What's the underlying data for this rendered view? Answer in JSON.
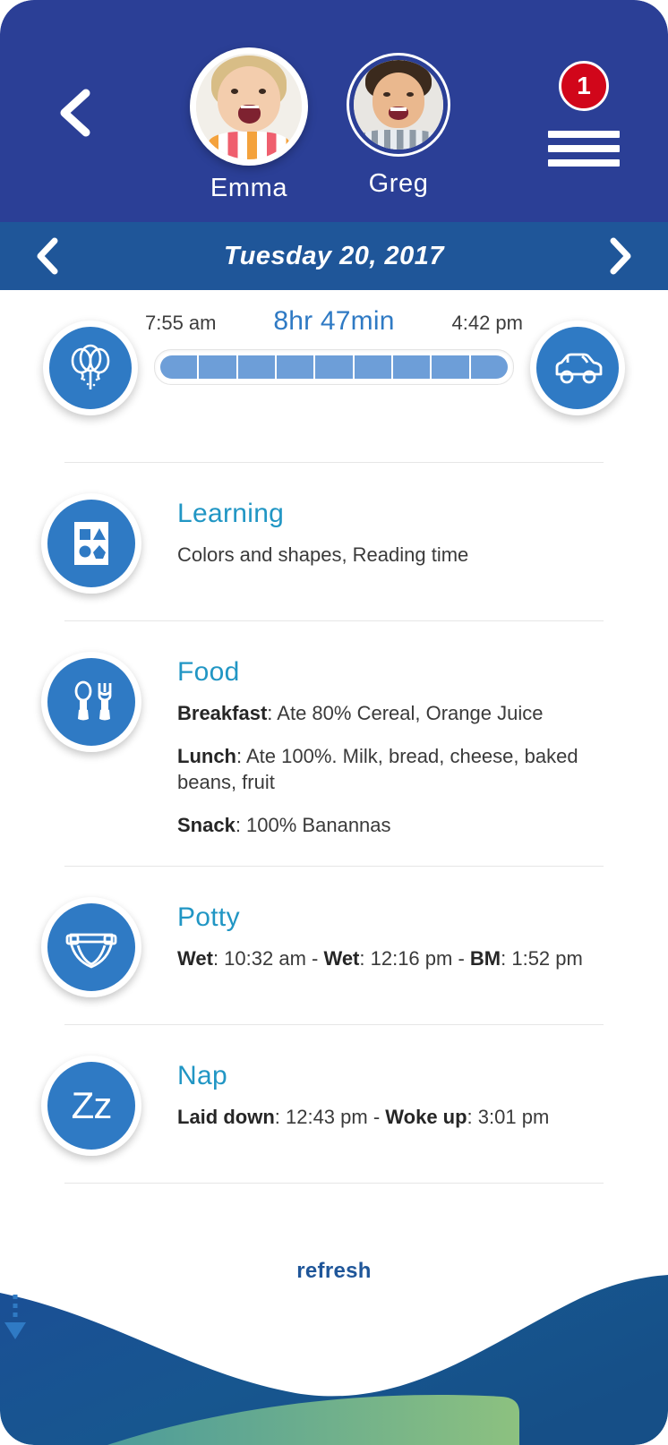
{
  "header": {
    "back_icon": "chevron-left-icon",
    "menu_icon": "hamburger-menu-icon",
    "notification_count": "1",
    "children": [
      {
        "name": "Emma",
        "selected": true,
        "avatar_icon": "child-avatar-photo"
      },
      {
        "name": "Greg",
        "selected": false,
        "avatar_icon": "child-avatar-photo"
      }
    ]
  },
  "date_bar": {
    "prev_icon": "chevron-left-icon",
    "next_icon": "chevron-right-icon",
    "date": "Tuesday 20, 2017"
  },
  "timeline": {
    "arrival_icon": "balloons-icon",
    "departure_icon": "car-icon",
    "arrival_time": "7:55 am",
    "duration": "8hr 47min",
    "departure_time": "4:42 pm",
    "segments": 9,
    "progress_percent": 100
  },
  "sections": [
    {
      "id": "learning",
      "icon": "shapes-board-icon",
      "title": "Learning",
      "lines": [
        {
          "label": "",
          "value": "Colors and shapes, Reading time"
        }
      ]
    },
    {
      "id": "food",
      "icon": "spoon-fork-icon",
      "title": "Food",
      "lines": [
        {
          "label": "Breakfast",
          "value": ": Ate 80% Cereal, Orange Juice"
        },
        {
          "label": "Lunch",
          "value": ": Ate 100%. Milk, bread, cheese, baked beans, fruit"
        },
        {
          "label": "Snack",
          "value": ": 100% Banannas"
        }
      ]
    },
    {
      "id": "potty",
      "icon": "diaper-icon",
      "title": "Potty",
      "lines": [
        {
          "label": "Wet",
          "value": ": 10:32 am - ",
          "label2": "Wet",
          "value2": ": 12:16 pm - ",
          "label3": "BM",
          "value3": ": 1:52 pm"
        }
      ]
    },
    {
      "id": "nap",
      "icon": "zz-sleep-icon",
      "title": "Nap",
      "lines": [
        {
          "label": "Laid down",
          "value": ": 12:43 pm - ",
          "label2": "Woke up",
          "value2": ": 3:01 pm"
        }
      ]
    }
  ],
  "footer": {
    "refresh_label": "refresh",
    "refresh_arrow_icon": "arrow-down-dashed-icon"
  },
  "colors": {
    "header_blue": "#2b3f96",
    "date_bar_blue": "#1f5699",
    "icon_blue": "#2f7ac4",
    "title_teal": "#2196c4",
    "badge_red": "#d1061a",
    "track_fill": "#6d9ed8",
    "wave_green": "#6fb88a"
  }
}
